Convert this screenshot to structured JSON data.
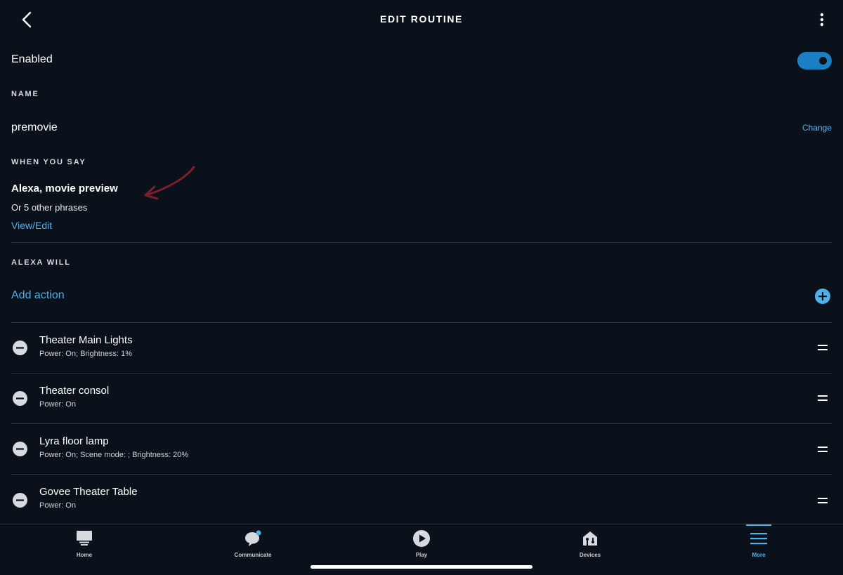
{
  "header": {
    "title": "EDIT ROUTINE"
  },
  "enabled": {
    "label": "Enabled",
    "state": "on",
    "toggle_color": "#1c7fc4"
  },
  "name_section": {
    "label": "NAME",
    "value": "premovie",
    "change_label": "Change"
  },
  "when_section": {
    "label": "WHEN YOU SAY",
    "phrase": "Alexa, movie preview",
    "other_phrases": "Or 5 other phrases",
    "view_edit_label": "View/Edit"
  },
  "alexa_will": {
    "label": "ALEXA WILL",
    "add_action_label": "Add action",
    "actions": [
      {
        "title": "Theater Main Lights",
        "detail": "Power: On; Brightness: 1%"
      },
      {
        "title": "Theater consol",
        "detail": "Power: On"
      },
      {
        "title": "Lyra floor lamp",
        "detail": "Power: On; Scene mode: ; Brightness: 20%"
      },
      {
        "title": "Govee Theater Table",
        "detail": "Power: On"
      }
    ]
  },
  "bottom_nav": {
    "items": [
      {
        "label": "Home",
        "icon": "home-icon"
      },
      {
        "label": "Communicate",
        "icon": "communicate-icon"
      },
      {
        "label": "Play",
        "icon": "play-icon"
      },
      {
        "label": "Devices",
        "icon": "devices-icon"
      },
      {
        "label": "More",
        "icon": "more-menu-icon",
        "active": true
      }
    ]
  },
  "colors": {
    "background": "#0a111a",
    "accent": "#4fb1e8",
    "annotation_arrow": "#7a1f2b"
  }
}
